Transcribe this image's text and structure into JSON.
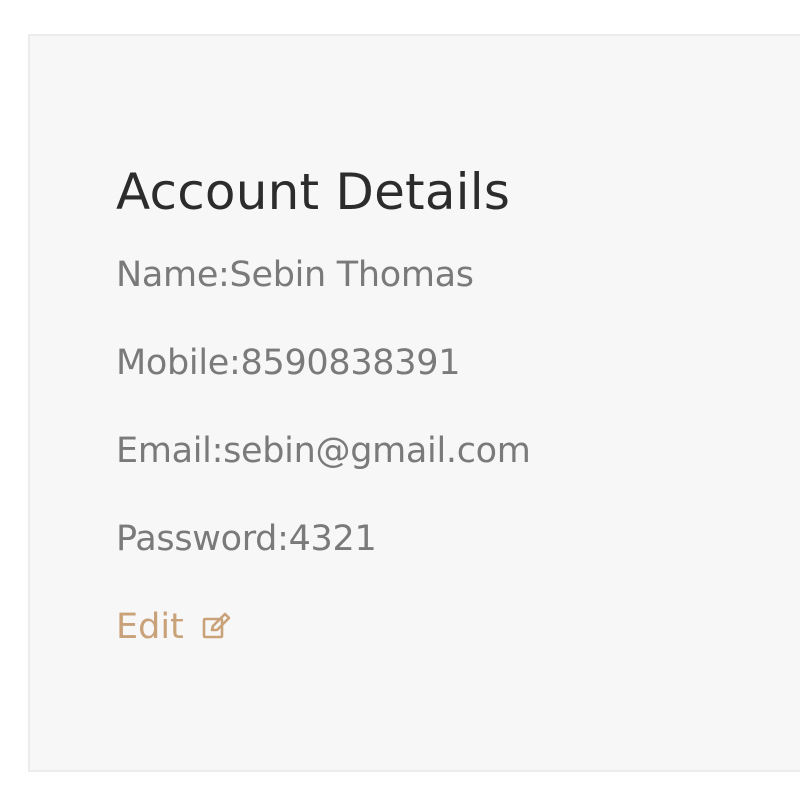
{
  "account": {
    "title": "Account Details",
    "name_text": "Name:Sebin Thomas",
    "mobile_text": "Mobile:8590838391",
    "email_text": "Email:sebin@gmail.com",
    "password_text": "Password:4321",
    "edit_label": "Edit",
    "edit_icon": "edit-icon"
  },
  "colors": {
    "background": "#ffffff",
    "panel": "#f7f7f7",
    "title": "#2c2c2c",
    "text": "#7a7a7a",
    "accent": "#c9a27a"
  }
}
